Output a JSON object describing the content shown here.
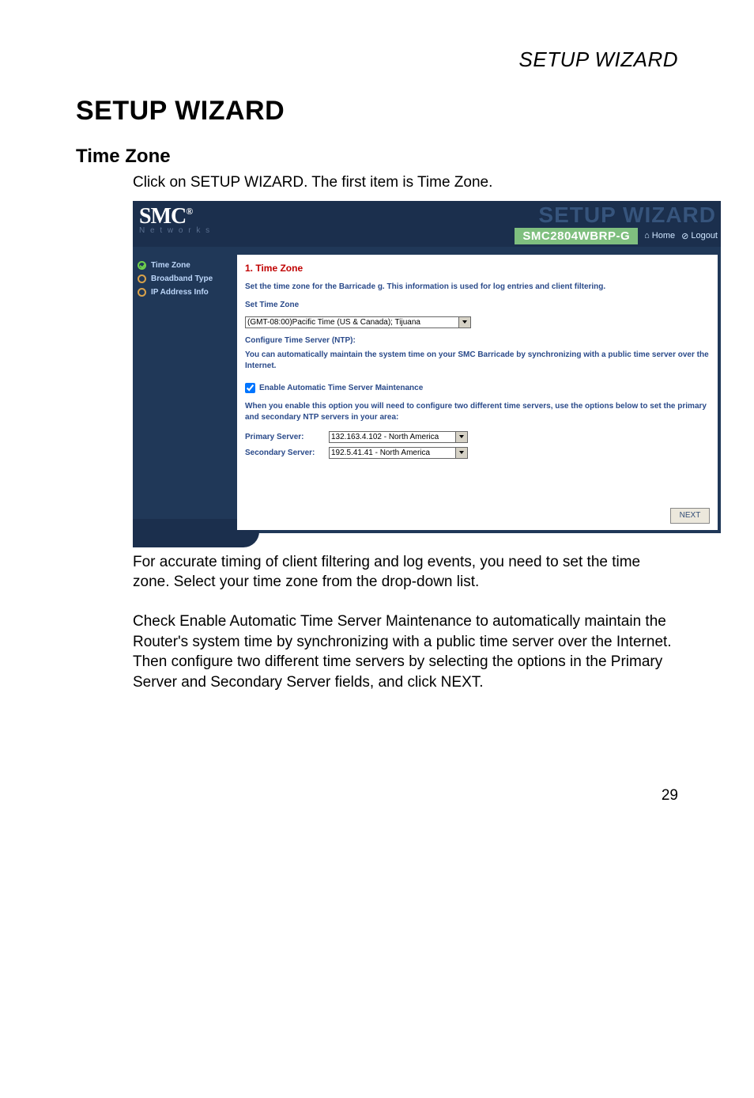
{
  "doc": {
    "running_header": "SETUP WIZARD",
    "h1": "SETUP WIZARD",
    "h2": "Time Zone",
    "intro": "Click on SETUP WIZARD. The first item is Time Zone.",
    "para1": "For accurate timing of client filtering and log events, you need to set the time zone. Select your time zone from the drop-down list.",
    "para2": "Check Enable Automatic Time Server Maintenance to automatically maintain the Router's system time by synchronizing with a public time server over the Internet. Then configure two different time servers by selecting the options in the Primary Server and Secondary Server fields, and click NEXT.",
    "page_number": "29"
  },
  "ss": {
    "brand": "SMC",
    "brand_reg": "®",
    "networks": "N e t w o r k s",
    "watermark": "SETUP WIZARD",
    "model": "SMC2804WBRP-G",
    "home": "Home",
    "logout": "Logout",
    "side": {
      "time_zone": "Time Zone",
      "broadband_type": "Broadband Type",
      "ip_address_info": "IP Address Info"
    },
    "content": {
      "title": "1. Time Zone",
      "desc": "Set the time zone for the Barricade g. This information is used for log entries and client filtering.",
      "set_tz": "Set Time Zone",
      "tz_value": "(GMT-08:00)Pacific Time (US & Canada); Tijuana",
      "ntp_title": "Configure Time Server (NTP):",
      "ntp_desc": "You can automatically maintain the system time on your SMC Barricade by synchronizing with a public time server over the Internet.",
      "enable_cb": "Enable Automatic Time Server Maintenance",
      "enable_help": "When you enable this option you will need to configure two different time servers, use the options below to set the primary and secondary NTP servers in your area:",
      "primary_lbl": "Primary Server:",
      "primary_val": "132.163.4.102 - North America",
      "secondary_lbl": "Secondary Server:",
      "secondary_val": "192.5.41.41 - North America",
      "next": "NEXT"
    }
  }
}
